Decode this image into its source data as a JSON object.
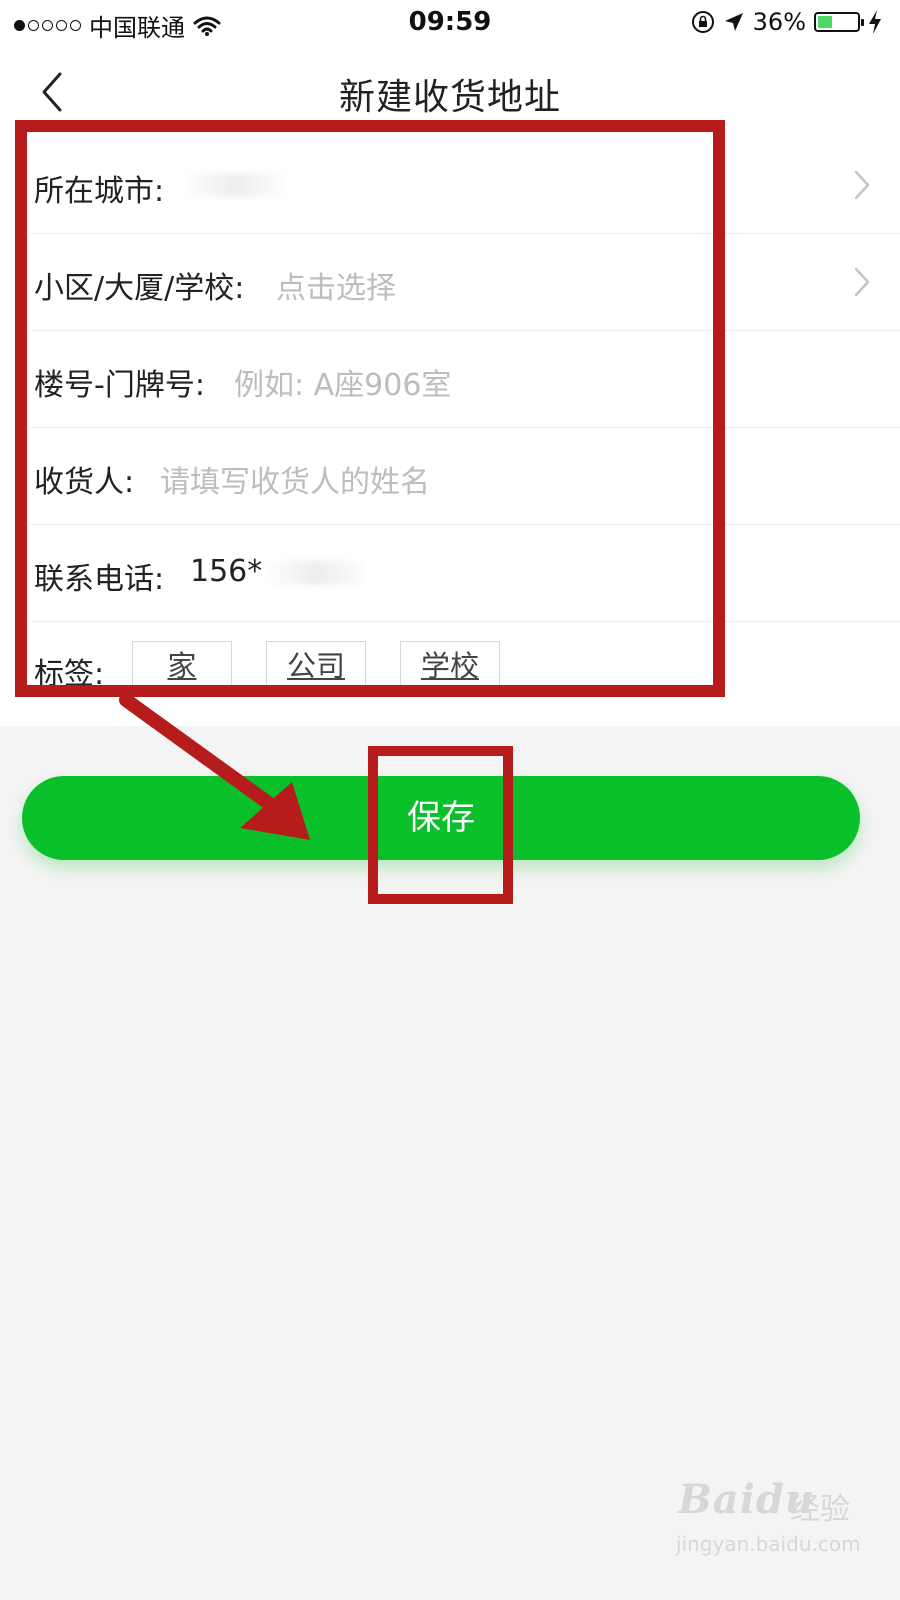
{
  "status_bar": {
    "carrier": "中国联通",
    "time": "09:59",
    "battery_percent": "36%",
    "battery_level": 0.36,
    "signal_bars_filled": 1,
    "signal_bars_total": 5
  },
  "nav": {
    "title": "新建收货地址",
    "back_icon": "chevron-left-icon"
  },
  "form": {
    "city": {
      "label": "所在城市:",
      "value": ""
    },
    "community": {
      "label": "小区/大厦/学校:",
      "placeholder": "点击选择"
    },
    "building": {
      "label": "楼号-门牌号:",
      "placeholder": "例如: A座906室"
    },
    "receiver": {
      "label": "收货人:",
      "placeholder": "请填写收货人的姓名"
    },
    "phone": {
      "label": "联系电话:",
      "value": "156*"
    },
    "tags": {
      "label": "标签:",
      "options": [
        "家",
        "公司",
        "学校"
      ]
    }
  },
  "save_label": "保存",
  "watermark": {
    "logo_left": "Bai",
    "logo_right": "du",
    "logo_cn": "经验",
    "url": "jingyan.baidu.com"
  },
  "colors": {
    "accent_green": "#0ac02a",
    "annotation_red": "#b71c1c",
    "placeholder_gray": "#bdbdbd"
  }
}
